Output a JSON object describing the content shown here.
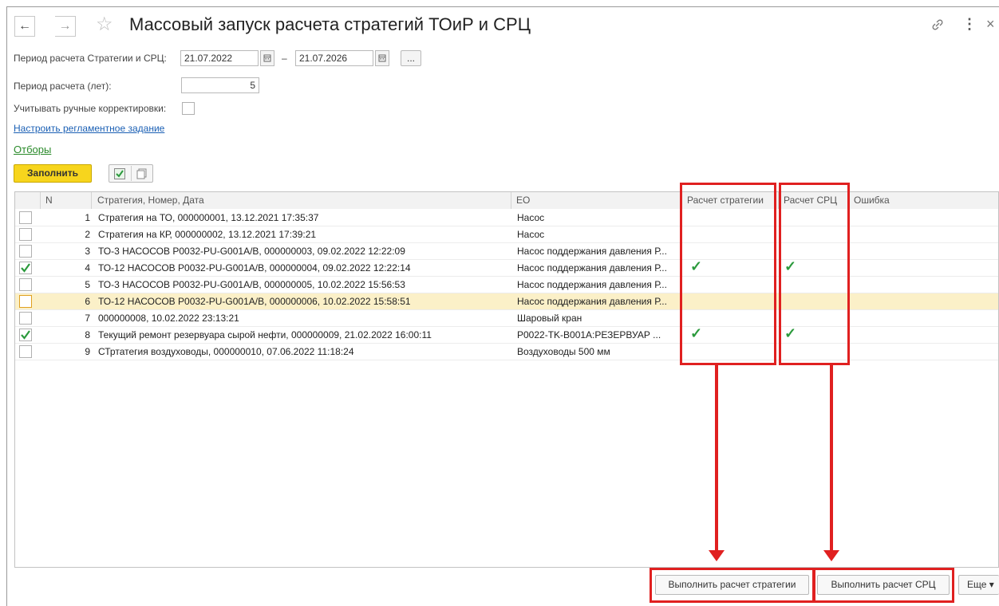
{
  "window": {
    "title": "Массовый запуск расчета стратегий ТОиР и СРЦ",
    "back_icon": "←",
    "forward_icon": "→",
    "star_icon": "☆",
    "link_icon": "🔗",
    "more_icon": "⋮",
    "close_icon": "×"
  },
  "form": {
    "period_label": "Период расчета Стратегии и СРЦ:",
    "period_from": "21.07.2022",
    "period_dash": "–",
    "period_to": "21.07.2026",
    "ellipsis_label": "...",
    "years_label": "Период расчета (лет):",
    "years_value": "5",
    "manual_label": "Учитывать ручные корректировки:",
    "schedule_link": "Настроить регламентное задание",
    "filters_link": "Отборы",
    "fill_button": "Заполнить"
  },
  "table": {
    "columns": [
      "N",
      "Стратегия, Номер, Дата",
      "ЕО",
      "Расчет стратегии",
      "Расчет СРЦ",
      "Ошибка"
    ],
    "rows": [
      {
        "n": "1",
        "strategy": "Стратегия на ТО, 000000001, 13.12.2021 17:35:37",
        "eo": "Насос",
        "checked": false,
        "calc": false,
        "src": false
      },
      {
        "n": "2",
        "strategy": "Стратегия на КР, 000000002, 13.12.2021 17:39:21",
        "eo": "Насос",
        "checked": false,
        "calc": false,
        "src": false
      },
      {
        "n": "3",
        "strategy": "ТО-3 НАСОСОВ P0032-PU-G001A/B, 000000003, 09.02.2022 12:22:09",
        "eo": "Насос поддержания давления Р...",
        "checked": false,
        "calc": false,
        "src": false
      },
      {
        "n": "4",
        "strategy": "ТО-12 НАСОСОВ P0032-PU-G001A/B, 000000004, 09.02.2022 12:22:14",
        "eo": "Насос поддержания давления Р...",
        "checked": true,
        "calc": true,
        "src": true
      },
      {
        "n": "5",
        "strategy": "ТО-3 НАСОСОВ P0032-PU-G001A/B, 000000005, 10.02.2022 15:56:53",
        "eo": "Насос поддержания давления Р...",
        "checked": false,
        "calc": false,
        "src": false
      },
      {
        "n": "6",
        "strategy": "ТО-12 НАСОСОВ P0032-PU-G001A/B, 000000006, 10.02.2022 15:58:51",
        "eo": "Насос поддержания давления Р...",
        "checked": false,
        "calc": false,
        "src": false
      },
      {
        "n": "7",
        "strategy": "000000008, 10.02.2022 23:13:21",
        "eo": "Шаровый кран",
        "checked": false,
        "calc": false,
        "src": false
      },
      {
        "n": "8",
        "strategy": "Текущий ремонт резервуара сырой нефти, 000000009, 21.02.2022 16:00:11",
        "eo": "P0022-TK-B001A:РЕЗЕРВУАР ...",
        "checked": true,
        "calc": true,
        "src": true
      },
      {
        "n": "9",
        "strategy": "СТртатегия воздуховоды, 000000010, 07.06.2022 11:18:24",
        "eo": "Воздуховоды 500 мм",
        "checked": false,
        "calc": false,
        "src": false
      }
    ],
    "check_mark": "✓"
  },
  "footer": {
    "run_strategy": "Выполнить расчет стратегии",
    "run_src": "Выполнить расчет СРЦ",
    "more": "Еще ▾"
  },
  "colors": {
    "accent_yellow": "#f7d51d",
    "annotation_red": "#e02020",
    "check_green": "#2b9a3c",
    "selected_row": "#fbf0c8"
  }
}
